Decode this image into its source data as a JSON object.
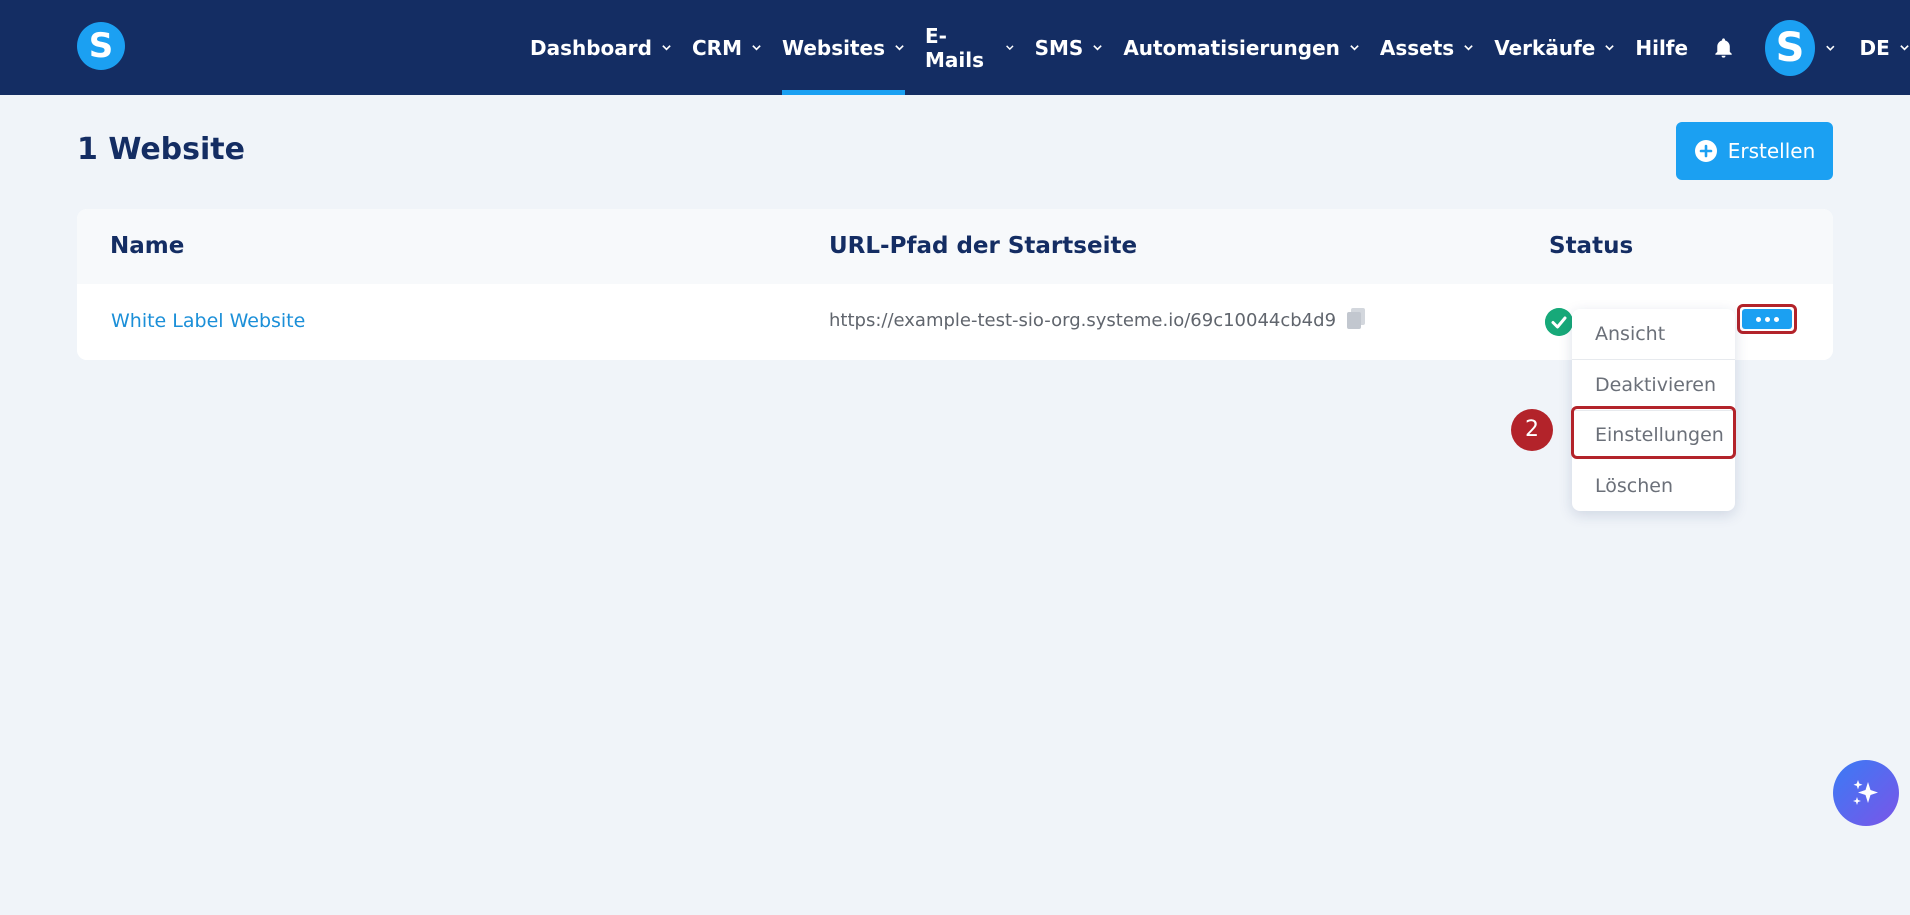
{
  "app": {
    "logo_letter": "S"
  },
  "nav": {
    "items": [
      {
        "label": "Dashboard",
        "has_dropdown": true
      },
      {
        "label": "CRM",
        "has_dropdown": true
      },
      {
        "label": "Websites",
        "has_dropdown": true,
        "active": true
      },
      {
        "label": "E-Mails",
        "has_dropdown": true
      },
      {
        "label": "SMS",
        "has_dropdown": true
      },
      {
        "label": "Automatisierungen",
        "has_dropdown": true
      },
      {
        "label": "Assets",
        "has_dropdown": true
      },
      {
        "label": "Verkäufe",
        "has_dropdown": true
      },
      {
        "label": "Hilfe",
        "has_dropdown": false
      }
    ],
    "avatar_letter": "S",
    "language": "DE",
    "icons": {
      "notifications": "bell-icon"
    }
  },
  "page": {
    "title": "1 Website",
    "create_button": "Erstellen"
  },
  "table": {
    "headers": {
      "name": "Name",
      "url": "URL-Pfad der Startseite",
      "status": "Status"
    },
    "rows": [
      {
        "name": "White Label Website",
        "url": "https://example-test-sio-org.systeme.io/69c10044cb4d9",
        "status": "active"
      }
    ]
  },
  "menu": {
    "items": [
      "Ansicht",
      "Deaktivieren",
      "Einstellungen",
      "Löschen"
    ],
    "highlighted": "Einstellungen"
  },
  "annotation": {
    "step": "2"
  },
  "colors": {
    "nav_bg": "#142d63",
    "accent": "#1ba0f2",
    "page_bg": "#f0f4f9",
    "link": "#1b8fd8",
    "status_ok": "#17a979",
    "highlight": "#b3232a"
  }
}
